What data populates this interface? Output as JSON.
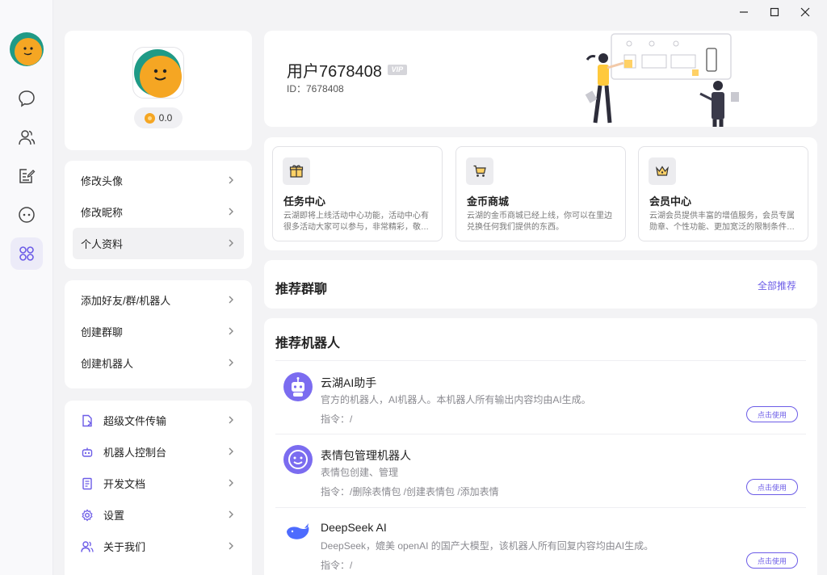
{
  "window": {
    "min_icon": "minimize-icon",
    "max_icon": "maximize-icon",
    "close_icon": "close-icon"
  },
  "rail": {
    "items": [
      {
        "name": "chat-icon"
      },
      {
        "name": "contacts-icon"
      },
      {
        "name": "notes-icon"
      },
      {
        "name": "bot-icon"
      },
      {
        "name": "apps-icon",
        "active": true
      }
    ]
  },
  "profile": {
    "coins": "0.0"
  },
  "menu1": [
    {
      "label": "修改头像"
    },
    {
      "label": "修改昵称"
    },
    {
      "label": "个人资料",
      "selected": true
    }
  ],
  "menu2": [
    {
      "label": "添加好友/群/机器人"
    },
    {
      "label": "创建群聊"
    },
    {
      "label": "创建机器人"
    }
  ],
  "menu3": [
    {
      "label": "超级文件传输",
      "icon": "file-transfer-icon"
    },
    {
      "label": "机器人控制台",
      "icon": "robot-console-icon"
    },
    {
      "label": "开发文档",
      "icon": "document-icon"
    },
    {
      "label": "设置",
      "icon": "settings-gear-icon"
    },
    {
      "label": "关于我们",
      "icon": "about-us-icon"
    }
  ],
  "user": {
    "name": "用户7678408",
    "vip": "VIP",
    "id_label": "ID：7678408"
  },
  "features": [
    {
      "title": "任务中心",
      "desc": "云湖即将上线活动中心功能，活动中心有很多活动大家可以参与，非常精彩，敬…",
      "icon": "gift-icon"
    },
    {
      "title": "金币商城",
      "desc": "云湖的金币商城已经上线，你可以在里边兑换任何我们提供的东西。",
      "icon": "cart-icon"
    },
    {
      "title": "会员中心",
      "desc": "云湖会员提供丰富的增值服务，会员专属勋章、个性功能、更加宽泛的限制条件…",
      "icon": "crown-icon"
    }
  ],
  "groups": {
    "title": "推荐群聊",
    "all_label": "全部推荐"
  },
  "bots": {
    "title": "推荐机器人",
    "items": [
      {
        "name": "云湖AI助手",
        "desc": "官方的机器人，AI机器人。本机器人所有输出内容均由AI生成。",
        "commands": "指令：/",
        "use_label": "点击使用",
        "avatar": "robot-avatar-icon"
      },
      {
        "name": "表情包管理机器人",
        "desc": "表情包创建、管理",
        "commands": "指令：/删除表情包   /创建表情包   /添加表情",
        "use_label": "点击使用",
        "avatar": "smiley-avatar-icon"
      },
      {
        "name": "DeepSeek AI",
        "desc": "DeepSeek，媲美 openAI 的国产大模型，该机器人所有回复内容均由AI生成。",
        "commands": "指令：/",
        "use_label": "点击使用",
        "avatar": "whale-avatar-icon"
      }
    ]
  },
  "colors": {
    "accent": "#6c5ce7",
    "avatar_bg": "#f5a623",
    "avatar_ring": "#1f9a86"
  }
}
